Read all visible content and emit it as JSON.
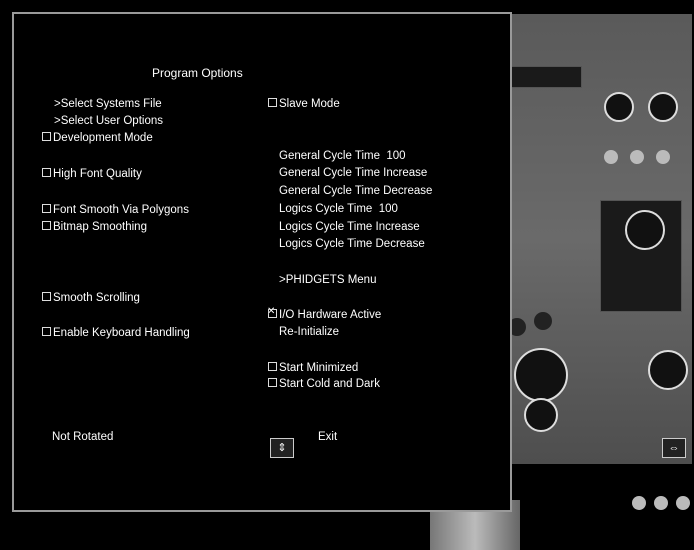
{
  "menu": {
    "title": "Program Options",
    "left": {
      "select_systems_file": ">Select Systems File",
      "select_user_options": ">Select User Options",
      "development_mode": "Development Mode",
      "high_font_quality": "High Font Quality",
      "font_smooth": "Font Smooth Via Polygons",
      "bitmap_smoothing": "Bitmap Smoothing",
      "smooth_scrolling": "Smooth Scrolling",
      "keyboard_handling": "Enable Keyboard Handling",
      "rotation": "Not Rotated"
    },
    "right": {
      "slave_mode": "Slave Mode",
      "general_cycle_time_label": "General Cycle Time",
      "general_cycle_time_value": "100",
      "general_cycle_increase": "General Cycle Time Increase",
      "general_cycle_decrease": "General Cycle Time Decrease",
      "logics_cycle_time_label": "Logics Cycle Time",
      "logics_cycle_time_value": "100",
      "logics_cycle_increase": "Logics Cycle Time Increase",
      "logics_cycle_decrease": "Logics Cycle Time Decrease",
      "phidgets_menu": ">PHIDGETS Menu",
      "io_hardware_active": "I/O Hardware Active",
      "reinitialize": "Re-Initialize",
      "start_minimized": "Start Minimized",
      "start_cold_dark": "Start Cold and Dark",
      "exit": "Exit"
    },
    "checks": {
      "development_mode": false,
      "high_font_quality": false,
      "font_smooth": false,
      "bitmap_smoothing": false,
      "smooth_scrolling": false,
      "keyboard_handling": false,
      "slave_mode": false,
      "io_hardware_active": true,
      "start_minimized": false,
      "start_cold_dark": false
    }
  }
}
